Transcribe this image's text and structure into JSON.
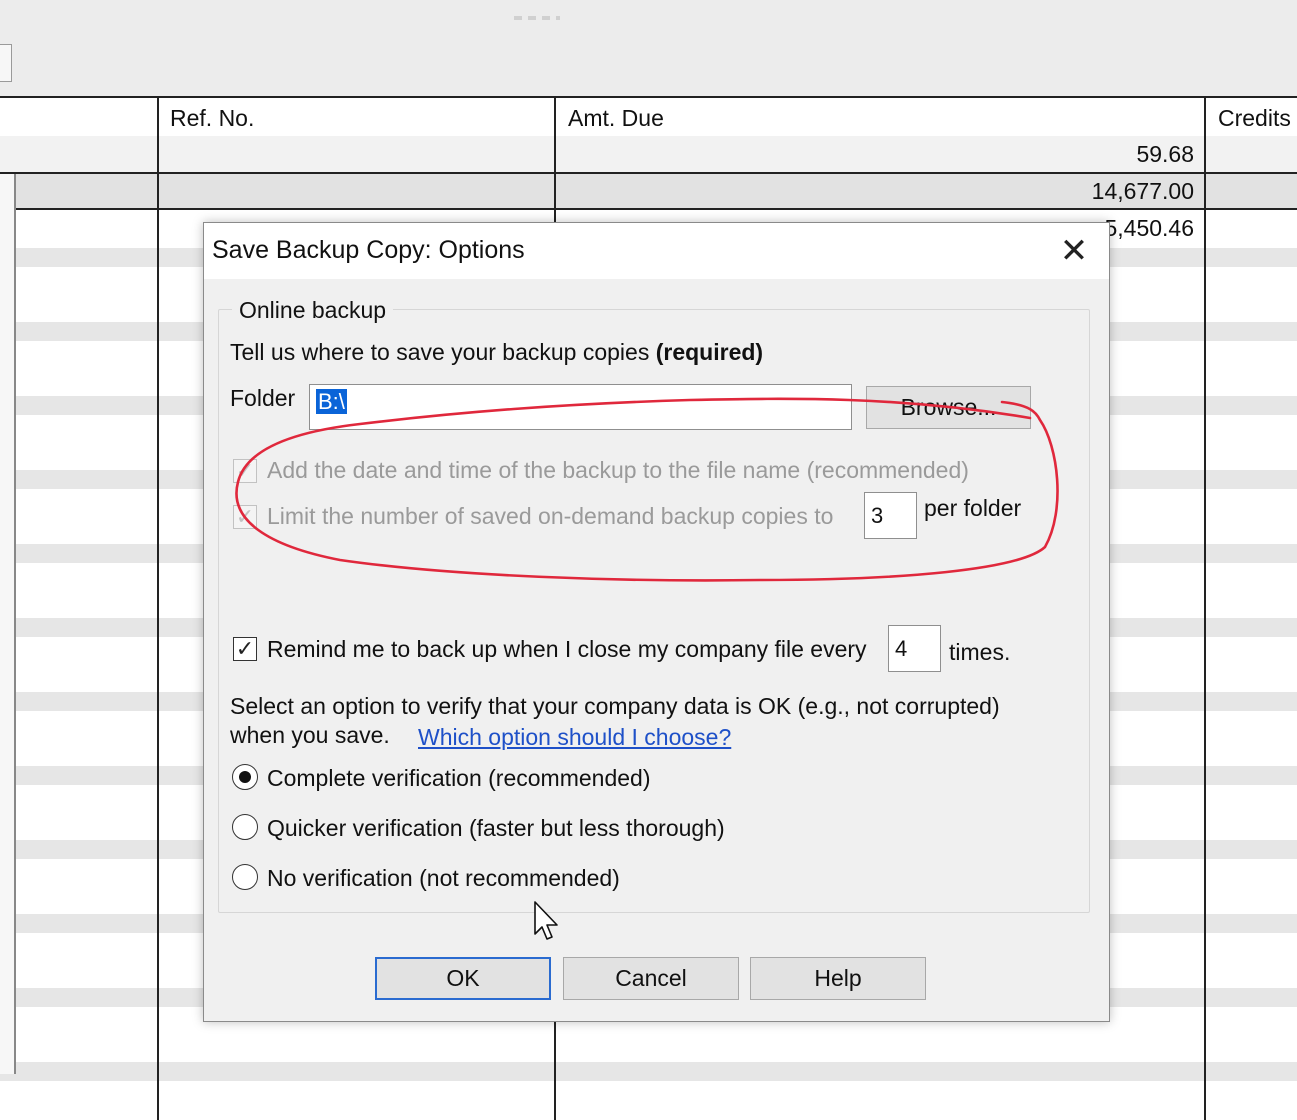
{
  "register": {
    "columns": [
      "Ref. No.",
      "Amt. Due",
      "Credits"
    ],
    "amounts": [
      "59.68",
      "14,677.00",
      "5,450.46"
    ]
  },
  "dialog": {
    "title": "Save Backup Copy: Options",
    "close_glyph": "✕",
    "group_label": "Online backup",
    "prompt_text": "Tell us where to save your backup copies",
    "prompt_required": "(required)",
    "folder_label": "Folder",
    "folder_value": "B:\\",
    "browse_label": "Browse...",
    "add_datetime_label": "Add the date and time of the backup to the file name (recommended)",
    "add_datetime_checked": true,
    "limit_label": "Limit the number of saved on-demand backup copies to",
    "limit_checked": true,
    "limit_value": "3",
    "per_folder_label": "per folder",
    "remind_label": "Remind me to back up when I close my company file every",
    "remind_checked": true,
    "remind_value": "4",
    "times_label": "times.",
    "verify_text_line1": "Select an option to verify that your company data is OK (e.g., not corrupted)",
    "verify_text_line2": "when you save.",
    "verify_link": "Which option should I choose?",
    "radio_options": [
      {
        "label": "Complete verification (recommended)",
        "selected": true
      },
      {
        "label": "Quicker verification (faster but less thorough)",
        "selected": false
      },
      {
        "label": "No verification (not recommended)",
        "selected": false
      }
    ],
    "ok_label": "OK",
    "cancel_label": "Cancel",
    "help_label": "Help"
  },
  "annotation_color": "#e0283c",
  "icons": [
    "close-icon",
    "checkmark-icon",
    "mouse-cursor-icon"
  ]
}
